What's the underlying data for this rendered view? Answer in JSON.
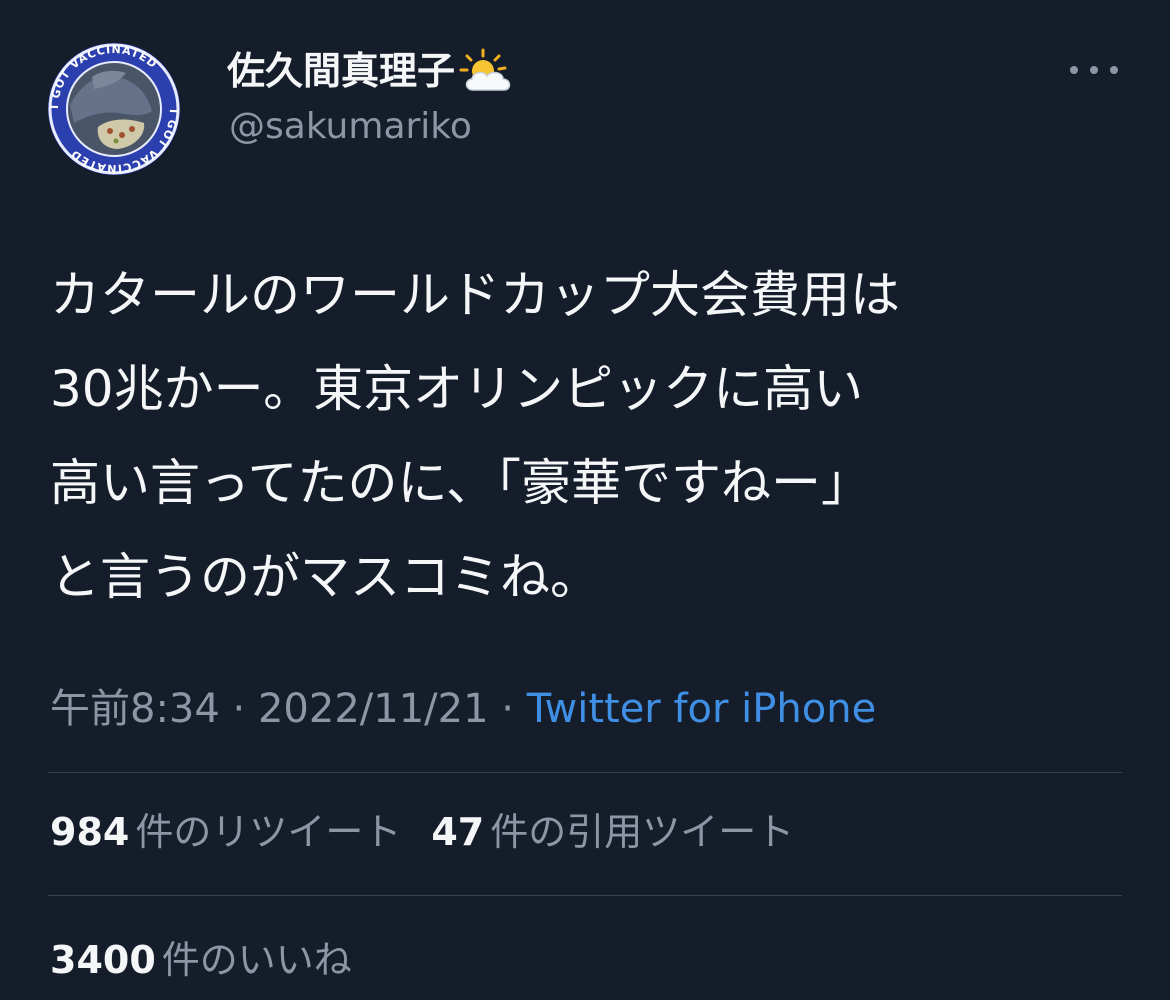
{
  "user": {
    "display_name": "佐久間真理子",
    "handle": "@sakumariko",
    "avatar_ring_text": "I GOT VACCINATED",
    "badge_icon": "sun-behind-cloud-icon"
  },
  "tweet": {
    "lines": [
      "カタールのワールドカップ大会費用は",
      "30兆かー。東京オリンピックに高い",
      "高い言ってたのに、「豪華ですねー」",
      "と言うのがマスコミね。"
    ]
  },
  "meta": {
    "time": "午前8:34",
    "separator": " · ",
    "date": "2022/11/21",
    "source": "Twitter for iPhone"
  },
  "stats": {
    "retweets": {
      "count": "984",
      "label": "件のリツイート"
    },
    "quotes": {
      "count": "47",
      "label": "件の引用ツイート"
    },
    "likes": {
      "count": "3400",
      "label": "件のいいね"
    }
  },
  "colors": {
    "background": "#161d2a",
    "text": "#f4f6f8",
    "secondary": "#8b97a5",
    "link": "#3f8fe5",
    "divider": "#38414d"
  }
}
